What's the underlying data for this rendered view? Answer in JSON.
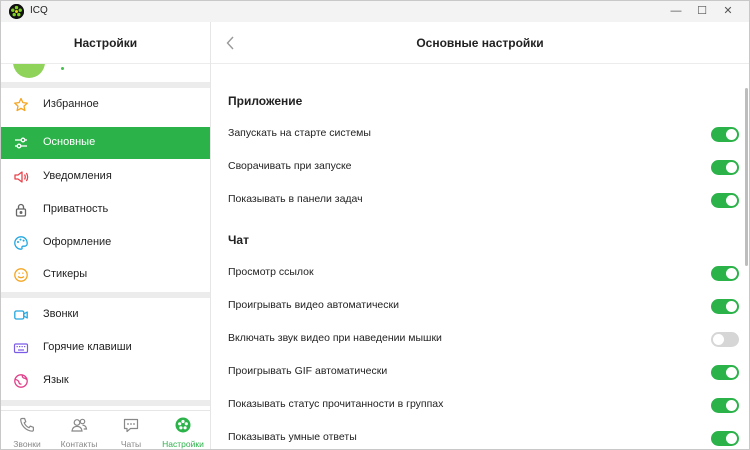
{
  "window": {
    "title": "ICQ",
    "minimize": "—",
    "maximize": "☐",
    "close": "✕"
  },
  "sidebar": {
    "title": "Настройки",
    "items": [
      {
        "label": "Избранное",
        "icon": "star-icon"
      },
      {
        "label": "Основные",
        "icon": "sliders-icon",
        "active": true
      },
      {
        "label": "Уведомления",
        "icon": "speaker-icon"
      },
      {
        "label": "Приватность",
        "icon": "lock-icon"
      },
      {
        "label": "Оформление",
        "icon": "palette-icon"
      },
      {
        "label": "Стикеры",
        "icon": "sticker-icon"
      },
      {
        "label": "Звонки",
        "icon": "video-camera-icon"
      },
      {
        "label": "Горячие клавиши",
        "icon": "keyboard-icon"
      },
      {
        "label": "Язык",
        "icon": "globe-icon"
      }
    ]
  },
  "bottom_tabs": [
    {
      "label": "Звонки",
      "icon": "phone-icon"
    },
    {
      "label": "Контакты",
      "icon": "contacts-icon"
    },
    {
      "label": "Чаты",
      "icon": "chat-icon"
    },
    {
      "label": "Настройки",
      "icon": "settings-gear-icon",
      "active": true
    }
  ],
  "main": {
    "title": "Основные настройки",
    "sections": [
      {
        "title": "Приложение",
        "rows": [
          {
            "label": "Запускать на старте системы",
            "enabled": true
          },
          {
            "label": "Сворачивать при запуске",
            "enabled": true
          },
          {
            "label": "Показывать в панели задач",
            "enabled": true
          }
        ]
      },
      {
        "title": "Чат",
        "rows": [
          {
            "label": "Просмотр ссылок",
            "enabled": true
          },
          {
            "label": "Проигрывать видео автоматически",
            "enabled": true
          },
          {
            "label": "Включать звук видео при наведении мышки",
            "enabled": false
          },
          {
            "label": "Проигрывать GIF автоматически",
            "enabled": true
          },
          {
            "label": "Показывать статус прочитанности в группах",
            "enabled": true
          },
          {
            "label": "Показывать умные ответы",
            "enabled": true
          }
        ]
      }
    ]
  },
  "colors": {
    "accent": "#2bb34a",
    "toggle_off": "#d6d6d6"
  }
}
